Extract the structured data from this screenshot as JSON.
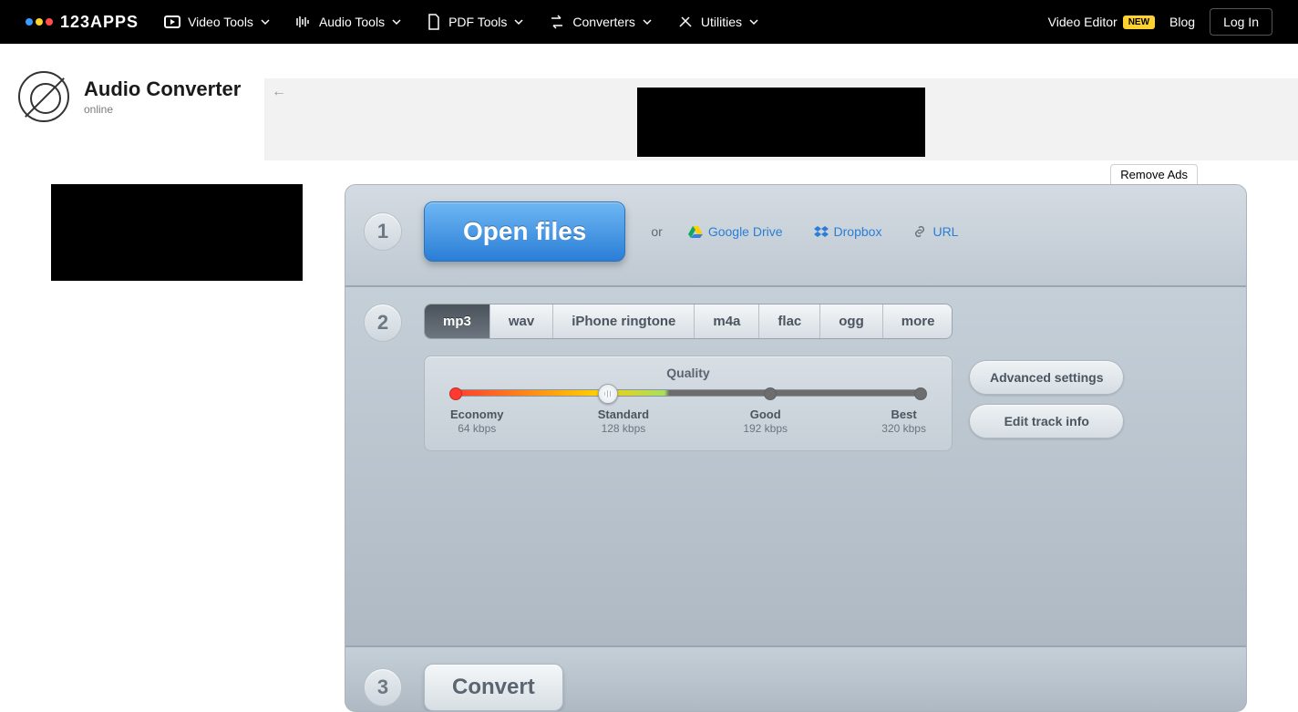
{
  "brand": "123APPS",
  "nav": {
    "items": [
      "Video Tools",
      "Audio Tools",
      "PDF Tools",
      "Converters",
      "Utilities"
    ],
    "video_editor": "Video Editor",
    "new_badge": "NEW",
    "blog": "Blog",
    "login": "Log In"
  },
  "app": {
    "title": "Audio Converter",
    "subtitle": "online"
  },
  "remove_ads": "Remove Ads",
  "step1": {
    "open": "Open files",
    "or": "or",
    "gdrive": "Google Drive",
    "dropbox": "Dropbox",
    "url": "URL"
  },
  "step2": {
    "tabs": [
      "mp3",
      "wav",
      "iPhone ringtone",
      "m4a",
      "flac",
      "ogg",
      "more"
    ],
    "active_tab": "mp3",
    "quality_title": "Quality",
    "levels": [
      {
        "name": "Economy",
        "value": "64 kbps"
      },
      {
        "name": "Standard",
        "value": "128 kbps"
      },
      {
        "name": "Good",
        "value": "192 kbps"
      },
      {
        "name": "Best",
        "value": "320 kbps"
      }
    ],
    "advanced": "Advanced settings",
    "edit_info": "Edit track info"
  },
  "step3": {
    "convert": "Convert"
  },
  "steps": {
    "one": "1",
    "two": "2",
    "three": "3"
  }
}
